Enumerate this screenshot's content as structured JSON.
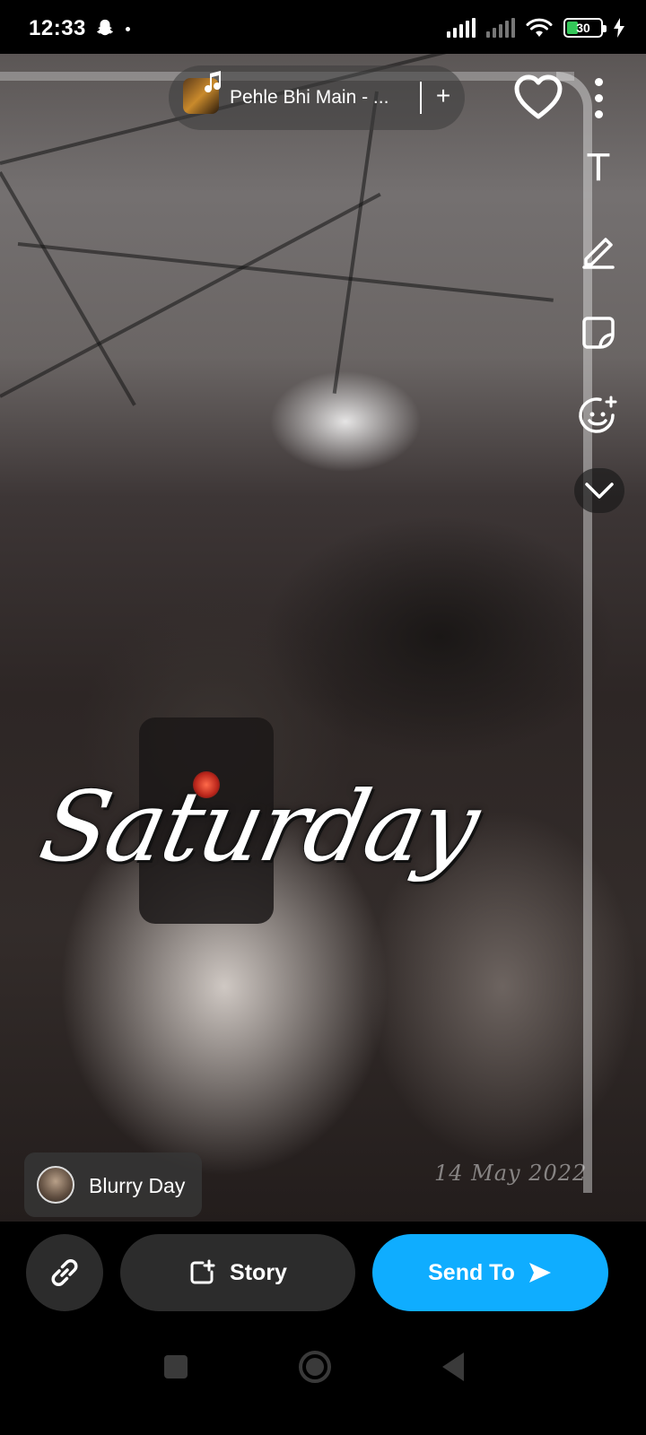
{
  "status_bar": {
    "time": "12:33",
    "battery_level": "30",
    "battery_fraction": 0.3,
    "icons": [
      "snapchat-ghost-icon",
      "dot-icon",
      "signal-icon",
      "signal-no-service-icon",
      "wifi-icon",
      "battery-icon",
      "charging-icon"
    ]
  },
  "music": {
    "title": "Pehle Bhi Main - ...",
    "add_symbol": "+",
    "icons": [
      "album-art",
      "music-note-icon"
    ]
  },
  "photo": {
    "overlay_text": "Saturday",
    "date_stamp": "14 May 2022"
  },
  "tools": {
    "text_label": "T",
    "icons": [
      "heart-icon",
      "more-icon",
      "text-icon",
      "pencil-icon",
      "sticker-icon",
      "lens-icon",
      "chevron-down-icon"
    ]
  },
  "chip": {
    "label": "Blurry Day"
  },
  "actions": {
    "story_label": "Story",
    "send_label": "Send To",
    "icons": [
      "link-icon",
      "add-story-icon",
      "send-arrow-icon"
    ]
  },
  "colors": {
    "send_button": "#0fadff",
    "dark_button": "#2c2c2c",
    "battery_fill": "#34c759"
  }
}
